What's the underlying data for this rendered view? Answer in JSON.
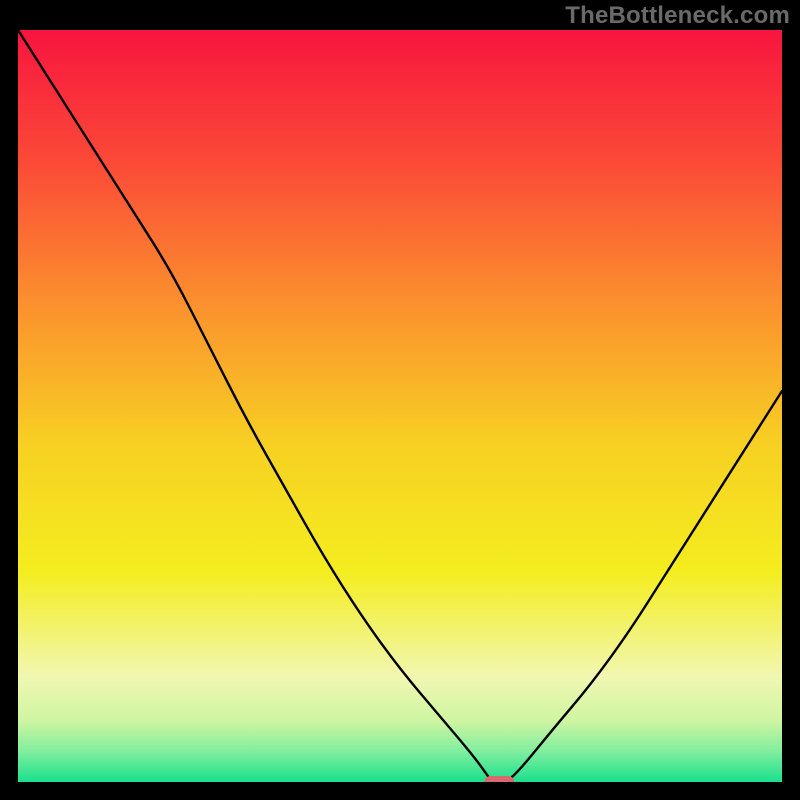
{
  "watermark": "TheBottleneck.com",
  "chart_data": {
    "type": "line",
    "title": "",
    "xlabel": "",
    "ylabel": "",
    "xlim": [
      0,
      100
    ],
    "ylim": [
      0,
      100
    ],
    "grid": false,
    "legend": false,
    "background_gradient_stops": [
      {
        "offset": 0.0,
        "color": "#f8153f"
      },
      {
        "offset": 0.18,
        "color": "#fb4b37"
      },
      {
        "offset": 0.36,
        "color": "#fb8f2e"
      },
      {
        "offset": 0.55,
        "color": "#f7d023"
      },
      {
        "offset": 0.72,
        "color": "#f4ed1f"
      },
      {
        "offset": 0.86,
        "color": "#f1f7b0"
      },
      {
        "offset": 0.92,
        "color": "#cdf5a2"
      },
      {
        "offset": 0.96,
        "color": "#7eee9e"
      },
      {
        "offset": 1.0,
        "color": "#1ae08e"
      }
    ],
    "series": [
      {
        "name": "bottleneck-curve",
        "x": [
          0,
          5,
          10,
          15,
          20,
          25,
          30,
          35,
          40,
          45,
          50,
          55,
          60,
          62,
          63,
          64,
          66,
          70,
          75,
          80,
          85,
          90,
          95,
          100
        ],
        "values": [
          100,
          92,
          84,
          76,
          68,
          58,
          48,
          39,
          30,
          22,
          15,
          9,
          3,
          0,
          0,
          0,
          2,
          7,
          13,
          20,
          28,
          36,
          44,
          52
        ]
      }
    ],
    "markers": [
      {
        "name": "optimal-point",
        "x": 63,
        "y": 0,
        "shape": "rounded-rect",
        "color": "#d86a6d"
      }
    ]
  }
}
